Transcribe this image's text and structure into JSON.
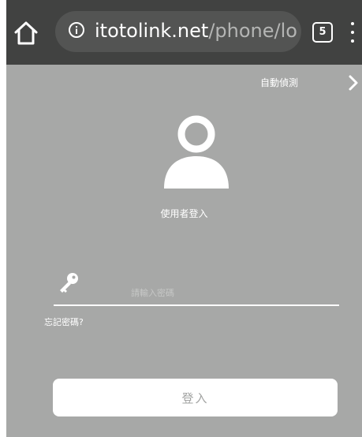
{
  "browser": {
    "url_host": "itotolink.net",
    "url_path": "/phone/lo",
    "tab_count": "5"
  },
  "page": {
    "auto_detect_label": "自動偵測",
    "user_login_label": "使用者登入",
    "password_placeholder": "請輸入密碼",
    "forgot_password_label": "忘記密碼?",
    "login_button_label": "登入"
  },
  "icons": {
    "home": "home-icon",
    "info": "info-icon",
    "menu": "more-vertical-icon",
    "next": "chevron-right-icon",
    "user": "user-icon",
    "key": "key-icon"
  },
  "colors": {
    "toolbar": "#414241",
    "urlbar": "#535453",
    "page_background": "#a7a8a7",
    "button_background": "#ffffff",
    "button_text": "#a2a3a2"
  }
}
